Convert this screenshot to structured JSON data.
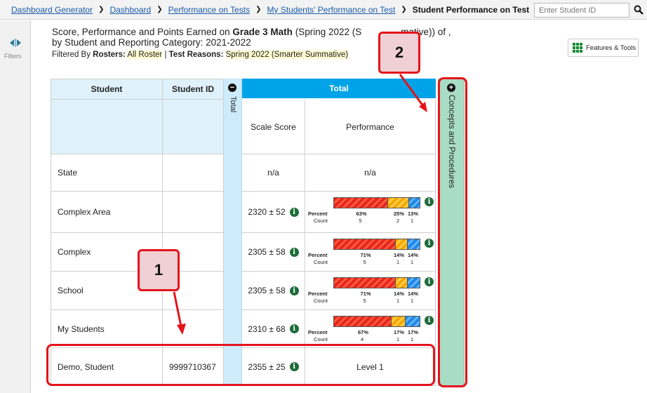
{
  "breadcrumb": {
    "items": [
      "Dashboard Generator",
      "Dashboard",
      "Performance on Tests",
      "My Students' Performance on Test"
    ],
    "current": "Student Performance on Test"
  },
  "search": {
    "placeholder": "Enter Student ID",
    "icon": "magnifier-icon"
  },
  "sidebar": {
    "filters_label": "Filters"
  },
  "heading": {
    "line1_pre": "Score, Performance and Points Earned on ",
    "line1_bold": "Grade 3 Math",
    "line1_post": " (Spring 2022 (S",
    "line1_tail": "mative)) of ,",
    "line2": "by Student and Reporting Category: 2021-2022",
    "filter_prefix": "Filtered By ",
    "rosters_label": "Rosters:",
    "rosters_value": "All Roster",
    "sep": " | ",
    "reasons_label": "Test Reasons:",
    "reasons_value": "Spring 2022 (Smarter Summative)"
  },
  "tools": {
    "label": "Features & Tools"
  },
  "table": {
    "col_student": "Student",
    "col_student_id": "Student ID",
    "total_strip_label": "Total",
    "total_header": "Total",
    "col_scale": "Scale Score",
    "col_performance": "Performance",
    "concepts_label": "Concepts and Procedures",
    "percent_label": "Percent",
    "count_label": "Count",
    "rows": [
      {
        "student": "State",
        "student_id": "",
        "scale": "n/a",
        "performance": "n/a"
      },
      {
        "student": "Complex Area",
        "student_id": "",
        "scale": "2320 ± 52",
        "bar": [
          63,
          25,
          13
        ],
        "pct": [
          "63%",
          "25%",
          "13%"
        ],
        "cnt": [
          "5",
          "2",
          "1"
        ]
      },
      {
        "student": "Complex",
        "student_id": "",
        "scale": "2305 ± 58",
        "bar": [
          71,
          14,
          14
        ],
        "pct": [
          "71%",
          "14%",
          "14%"
        ],
        "cnt": [
          "5",
          "1",
          "1"
        ]
      },
      {
        "student": "School",
        "student_id": "",
        "scale": "2305 ± 58",
        "bar": [
          71,
          14,
          14
        ],
        "pct": [
          "71%",
          "14%",
          "14%"
        ],
        "cnt": [
          "5",
          "1",
          "1"
        ]
      },
      {
        "student": "My Students",
        "student_id": "",
        "scale": "2310 ± 68",
        "bar": [
          67,
          17,
          17
        ],
        "pct": [
          "67%",
          "17%",
          "17%"
        ],
        "cnt": [
          "4",
          "1",
          "1"
        ]
      },
      {
        "student": "Demo, Student",
        "student_id": "9999710367",
        "scale": "2355 ± 25",
        "performance": "Level 1"
      }
    ]
  },
  "callouts": {
    "one": "1",
    "two": "2"
  },
  "colors": {
    "total_header": "#00a3e8",
    "concepts": "#a8dcc4",
    "callout_border": "#e4141b"
  }
}
